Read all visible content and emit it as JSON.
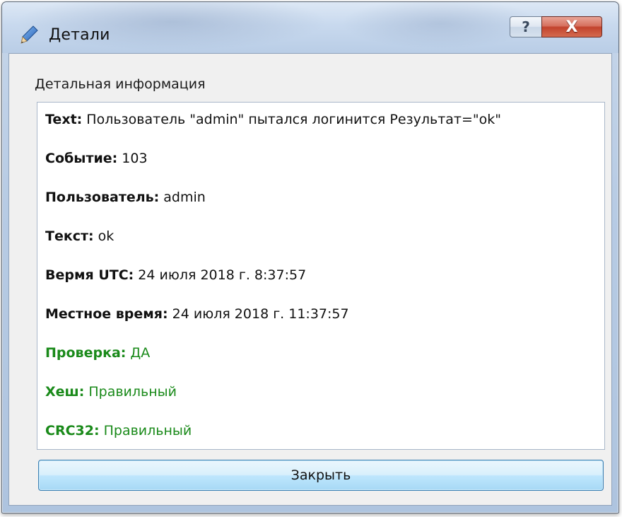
{
  "window": {
    "title": "Детали",
    "help_glyph": "?",
    "close_glyph": "X"
  },
  "group": {
    "label": "Детальная информация"
  },
  "details": [
    {
      "key": "Text:",
      "value": " Пользователь \"admin\" пытался логинится Результат=\"ok\"",
      "status": "normal"
    },
    {
      "key": "Событие:",
      "value": " 103",
      "status": "normal"
    },
    {
      "key": "Пользователь:",
      "value": " admin",
      "status": "normal"
    },
    {
      "key": "Текст:",
      "value": " ok",
      "status": "normal"
    },
    {
      "key": "Вермя UTC:",
      "value": " 24 июля 2018 г. 8:37:57",
      "status": "normal"
    },
    {
      "key": "Местное время:",
      "value": " 24 июля 2018 г. 11:37:57",
      "status": "normal"
    },
    {
      "key": "Проверка:",
      "value": " ДА",
      "status": "ok"
    },
    {
      "key": "Хеш:",
      "value": " Правильный",
      "status": "ok"
    },
    {
      "key": "CRC32:",
      "value": " Правильный",
      "status": "ok"
    }
  ],
  "actions": {
    "close_label": "Закрыть"
  },
  "colors": {
    "ok": "#1a8a1a",
    "normal": "#111111"
  },
  "icons": {
    "app": "pencil-icon",
    "help": "help-icon",
    "close": "close-icon"
  }
}
